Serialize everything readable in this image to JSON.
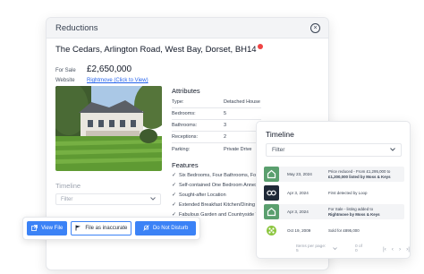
{
  "modal": {
    "title": "Reductions",
    "close_glyph": "×",
    "address": "The Cedars, Arlington Road, West Bay, Dorset, BH14",
    "status_label": "For Sale",
    "price": "£2,650,000",
    "website_label": "Website",
    "website_link": "Rightmove (Click to View)",
    "attributes_title": "Attributes",
    "attributes": [
      {
        "key": "Type:",
        "value": "Detached House"
      },
      {
        "key": "Bedrooms:",
        "value": "5"
      },
      {
        "key": "Bathrooms:",
        "value": "3"
      },
      {
        "key": "Receptions:",
        "value": "2"
      },
      {
        "key": "Parking:",
        "value": "Private Drive"
      }
    ],
    "features_title": "Features",
    "features": [
      "Six Bedrooms, Four Bathrooms, Four",
      "Self-contained One Bedroom Annex",
      "Sought-after Location",
      "Extended Breakfast Kitchen/Dining R",
      "Fabulous Garden and Countryside Vie"
    ],
    "timeline_title": "Timeline",
    "timeline_filter_placeholder": "Filter"
  },
  "action_bar": {
    "view_file": "View File",
    "file_inaccurate": "File as inaccurate",
    "do_not_disturb": "Do Not Disturb"
  },
  "timeline_panel": {
    "title": "Timeline",
    "filter_placeholder": "Filter",
    "entries": [
      {
        "icon": "zoopla-house-icon",
        "date": "May 23, 2024",
        "line1": "Price reduced - From £1,295,000 to",
        "line2": "£1,200,000 listed by Moss & Keys"
      },
      {
        "icon": "loop-logo-icon",
        "date": "Apr 3, 2024",
        "line1": "First detected by Loop",
        "line2": ""
      },
      {
        "icon": "zoopla-house-icon",
        "date": "Apr 3, 2024",
        "line1": "For Sale - listing added to",
        "line2": "Rightmove by Moss & Keys"
      },
      {
        "icon": "onthemarket-logo-icon",
        "date": "Oct 19, 2009",
        "line1": "Sold for £895,000",
        "line2": ""
      }
    ],
    "pager": {
      "items_per_page": "Items per page: 5",
      "range": "0 of 0"
    }
  },
  "colors": {
    "accent": "#3b82f6",
    "zoopla_green": "#5a9f6e",
    "loop_dark": "#1f2937",
    "alert_red": "#ef4444"
  }
}
